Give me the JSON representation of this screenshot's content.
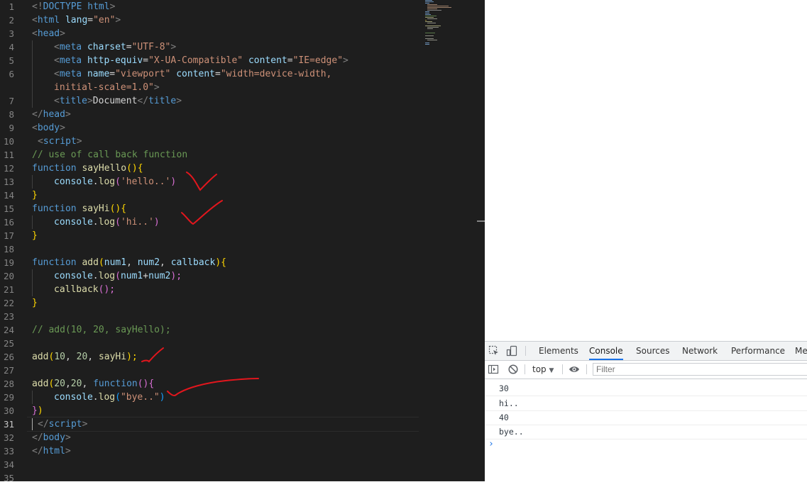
{
  "editor": {
    "lines": [
      {
        "n": "1"
      },
      {
        "n": "2"
      },
      {
        "n": "3"
      },
      {
        "n": "4"
      },
      {
        "n": "5"
      },
      {
        "n": "6"
      },
      {
        "n": ""
      },
      {
        "n": "7"
      },
      {
        "n": "8"
      },
      {
        "n": "9"
      },
      {
        "n": "10"
      },
      {
        "n": "11"
      },
      {
        "n": "12"
      },
      {
        "n": "13"
      },
      {
        "n": "14"
      },
      {
        "n": "15"
      },
      {
        "n": "16"
      },
      {
        "n": "17"
      },
      {
        "n": "18"
      },
      {
        "n": "19"
      },
      {
        "n": "20"
      },
      {
        "n": "21"
      },
      {
        "n": "22"
      },
      {
        "n": "23"
      },
      {
        "n": "24"
      },
      {
        "n": "25"
      },
      {
        "n": "26"
      },
      {
        "n": "27"
      },
      {
        "n": "28"
      },
      {
        "n": "29"
      },
      {
        "n": "30"
      },
      {
        "n": "31"
      },
      {
        "n": "32"
      },
      {
        "n": "33"
      },
      {
        "n": "34"
      },
      {
        "n": "35"
      }
    ],
    "active_line": "31",
    "code": {
      "l1_a": "<!",
      "l1_b": "DOCTYPE",
      "l1_c": " html",
      "l1_d": ">",
      "l2_a": "<",
      "l2_b": "html",
      "l2_c": " lang",
      "l2_d": "=",
      "l2_e": "\"en\"",
      "l2_f": ">",
      "l3_a": "<",
      "l3_b": "head",
      "l3_c": ">",
      "l4_a": "<",
      "l4_b": "meta",
      "l4_c": " charset",
      "l4_d": "=",
      "l4_e": "\"UTF-8\"",
      "l4_f": ">",
      "l5_a": "<",
      "l5_b": "meta",
      "l5_c": " http-equiv",
      "l5_d": "=",
      "l5_e": "\"X-UA-Compatible\"",
      "l5_f": " content",
      "l5_g": "=",
      "l5_h": "\"IE=edge\"",
      "l5_i": ">",
      "l6_a": "<",
      "l6_b": "meta",
      "l6_c": " name",
      "l6_d": "=",
      "l6_e": "\"viewport\"",
      "l6_f": " content",
      "l6_g": "=",
      "l6_h": "\"width=device-width,",
      "l6w_a": "initial-scale=1.0\"",
      "l6w_b": ">",
      "l7_a": "<",
      "l7_b": "title",
      "l7_c": ">",
      "l7_d": "Document",
      "l7_e": "</",
      "l7_f": "title",
      "l7_g": ">",
      "l8_a": "</",
      "l8_b": "head",
      "l8_c": ">",
      "l9_a": "<",
      "l9_b": "body",
      "l9_c": ">",
      "l10_a": "<",
      "l10_b": "script",
      "l10_c": ">",
      "l11": "// use of call back function",
      "l12_a": "function",
      "l12_b": " sayHello",
      "l12_c": "(){",
      "l13_a": "console",
      "l13_b": ".",
      "l13_c": "log",
      "l13_d": "(",
      "l13_e": "'hello..'",
      "l13_f": ")",
      "l14": "}",
      "l15_a": "function",
      "l15_b": " sayHi",
      "l15_c": "(){",
      "l16_a": "console",
      "l16_b": ".",
      "l16_c": "log",
      "l16_d": "(",
      "l16_e": "'hi..'",
      "l16_f": ")",
      "l17": "}",
      "l19_a": "function",
      "l19_b": " add",
      "l19_c": "(",
      "l19_d": "num1",
      "l19_e": ", ",
      "l19_f": "num2",
      "l19_g": ", ",
      "l19_h": "callback",
      "l19_i": "){",
      "l20_a": "console",
      "l20_b": ".",
      "l20_c": "log",
      "l20_d": "(",
      "l20_e": "num1",
      "l20_f": "+",
      "l20_g": "num2",
      "l20_h": ");",
      "l21_a": "callback",
      "l21_b": "();",
      "l22": "}",
      "l24": "// add(10, 20, sayHello);",
      "l26_a": "add",
      "l26_b": "(",
      "l26_c": "10",
      "l26_d": ", ",
      "l26_e": "20",
      "l26_f": ", ",
      "l26_g": "sayHi",
      "l26_h": ");",
      "l28_a": "add",
      "l28_b": "(",
      "l28_c": "20",
      "l28_d": ",",
      "l28_e": "20",
      "l28_f": ", ",
      "l28_g": "function",
      "l28_h": "(){",
      "l29_a": "console",
      "l29_b": ".",
      "l29_c": "log",
      "l29_d": "(",
      "l29_e": "\"bye..\"",
      "l29_f": ")",
      "l30_a": "}",
      "l30_b": ")",
      "l31_a": "</",
      "l31_b": "script",
      "l31_c": ">",
      "l32_a": "</",
      "l32_b": "body",
      "l32_c": ">",
      "l33_a": "</",
      "l33_b": "html",
      "l33_c": ">"
    }
  },
  "devtools": {
    "tabs": [
      "Elements",
      "Console",
      "Sources",
      "Network",
      "Performance",
      "Me"
    ],
    "active_tab": "Console",
    "context": "top",
    "filter_placeholder": "Filter",
    "logs": [
      "30",
      "hi..",
      "40",
      "bye.."
    ],
    "prompt": "›"
  },
  "colors": {
    "editor_bg": "#1e1e1e",
    "annotation": "#e3161d",
    "accent": "#1a73e8"
  },
  "icons": [
    "inspect-element-icon",
    "device-toolbar-icon",
    "sidebar-toggle-icon",
    "clear-console-icon",
    "dropdown-arrow-icon",
    "eye-icon"
  ]
}
